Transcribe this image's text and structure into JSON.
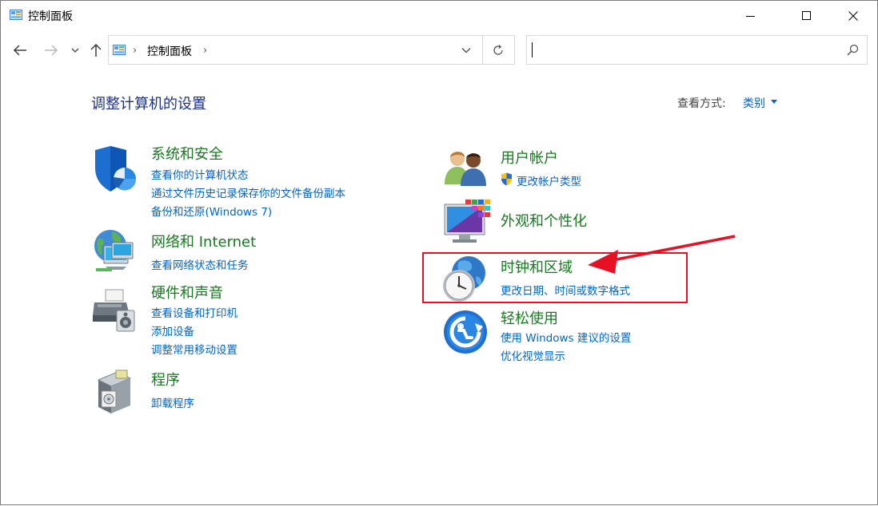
{
  "window": {
    "title": "控制面板",
    "minimize_icon": "minimize-icon",
    "maximize_icon": "maximize-icon",
    "close_icon": "close-icon"
  },
  "address_bar": {
    "path": "控制面板",
    "back_icon": "back-arrow-icon",
    "forward_icon": "forward-arrow-icon",
    "recent_icon": "chevron-down-icon",
    "up_icon": "up-arrow-icon",
    "refresh_icon": "refresh-icon"
  },
  "search": {
    "placeholder": "",
    "value": "",
    "icon": "search-icon"
  },
  "main": {
    "heading": "调整计算机的设置",
    "view_by_label": "查看方式:",
    "view_by_value": "类别",
    "left_categories": [
      {
        "title": "系统和安全",
        "icon": "shield-icon",
        "links": [
          "查看你的计算机状态",
          "通过文件历史记录保存你的文件备份副本",
          "备份和还原(Windows 7)"
        ]
      },
      {
        "title": "网络和 Internet",
        "icon": "network-globe-icon",
        "links": [
          "查看网络状态和任务"
        ]
      },
      {
        "title": "硬件和声音",
        "icon": "printer-speaker-icon",
        "links": [
          "查看设备和打印机",
          "添加设备",
          "调整常用移动设置"
        ]
      },
      {
        "title": "程序",
        "icon": "programs-box-icon",
        "links": [
          "卸载程序"
        ]
      }
    ],
    "right_categories": [
      {
        "title": "用户帐户",
        "icon": "users-icon",
        "links": [
          "更改帐户类型"
        ]
      },
      {
        "title": "外观和个性化",
        "icon": "monitor-personalize-icon",
        "links": []
      },
      {
        "title": "时钟和区域",
        "icon": "clock-globe-icon",
        "links": [
          "更改日期、时间或数字格式"
        ]
      },
      {
        "title": "轻松使用",
        "icon": "ease-of-access-icon",
        "links": [
          "使用 Windows 建议的设置",
          "优化视觉显示"
        ]
      }
    ]
  },
  "annotation": {
    "highlight_color": "#e81123",
    "target": "时钟和区域"
  },
  "colors": {
    "heading": "#1e3287",
    "category_title": "#157b1e",
    "link": "#0066cc",
    "annotation": "#e81123"
  }
}
